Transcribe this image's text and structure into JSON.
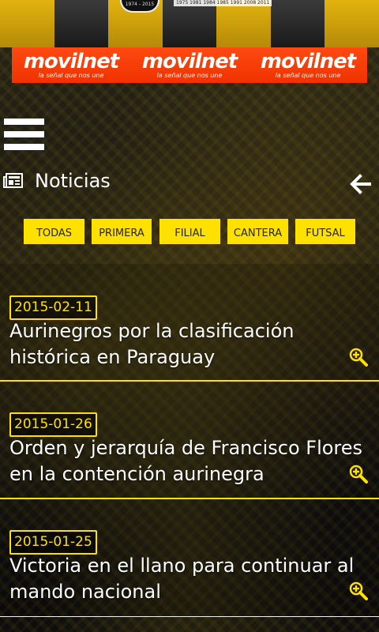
{
  "banner": {
    "badge_text": "1974 - 2015",
    "years_text": "1975 1981 1984 1985 1991 2008 2011"
  },
  "sponsor": {
    "logos": [
      {
        "name": "movilnet",
        "tagline": "la señal que nos une"
      },
      {
        "name": "movilnet",
        "tagline": "la señal que nos une"
      },
      {
        "name": "movilnet",
        "tagline": "la señal que nos une"
      }
    ],
    "brand_color": "#ef3200"
  },
  "header": {
    "menu_icon": "hamburger-menu-icon",
    "news_icon": "newspaper-icon",
    "title": "Noticias",
    "back_icon": "arrow-left-icon"
  },
  "tabs": [
    {
      "label": "TODAS"
    },
    {
      "label": "PRIMERA"
    },
    {
      "label": "FILIAL"
    },
    {
      "label": "CANTERA"
    },
    {
      "label": "FUTSAL"
    }
  ],
  "colors": {
    "accent": "#ffe100",
    "text": "#ffffff"
  },
  "news": [
    {
      "date": "2015-02-11",
      "title": "Aurinegros por la clasificación histórica en Paraguay",
      "action_icon": "zoom-in-icon"
    },
    {
      "date": "2015-01-26",
      "title": "Orden y jerarquía de Francisco Flores en la contención aurinegra",
      "action_icon": "zoom-in-icon"
    },
    {
      "date": "2015-01-25",
      "title": "Victoria en el llano para continuar al mando nacional",
      "action_icon": "zoom-in-icon"
    }
  ]
}
